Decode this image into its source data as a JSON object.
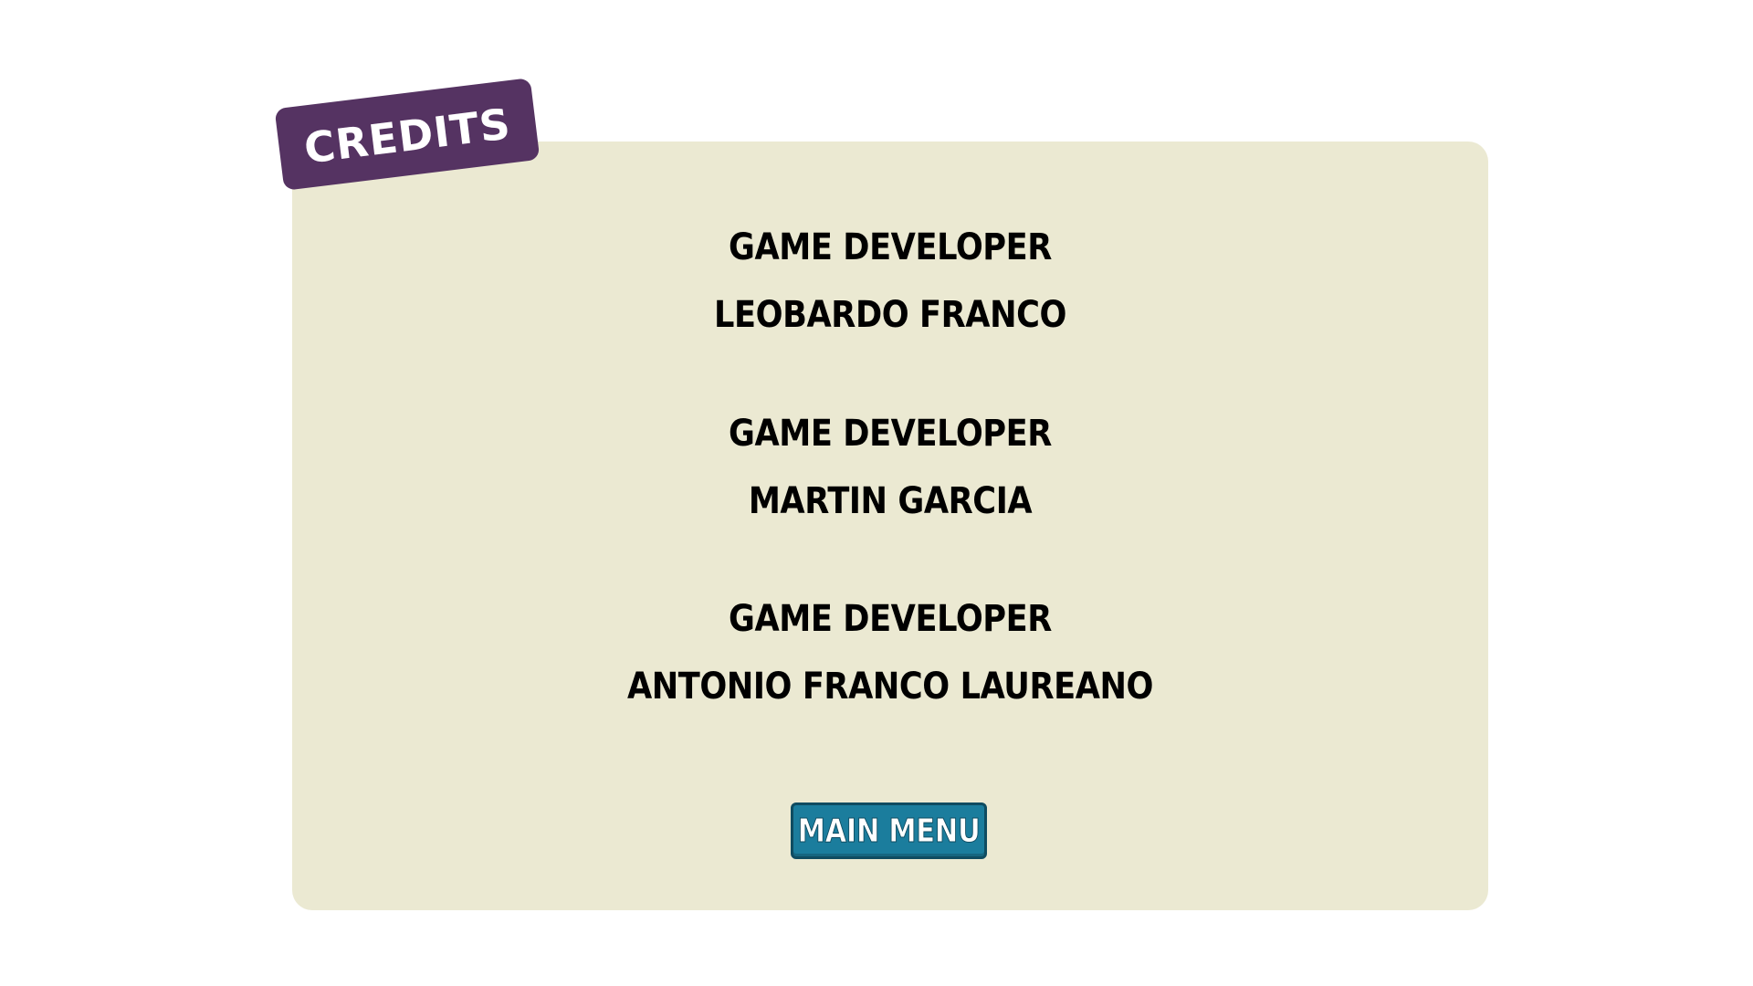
{
  "header": {
    "title": "CREDITS"
  },
  "credits": [
    {
      "role": "GAME DEVELOPER",
      "name": "LEOBARDO FRANCO"
    },
    {
      "role": "GAME DEVELOPER",
      "name": "MARTIN GARCIA"
    },
    {
      "role": "GAME DEVELOPER",
      "name": "ANTONIO FRANCO LAUREANO"
    }
  ],
  "buttons": {
    "main_menu_label": "MAIN MENU"
  },
  "colors": {
    "panel_background": "#ebe9d2",
    "title_tag": "#553362",
    "button": "#1b7d9d",
    "button_border": "#0f4c61",
    "text": "#000000"
  }
}
